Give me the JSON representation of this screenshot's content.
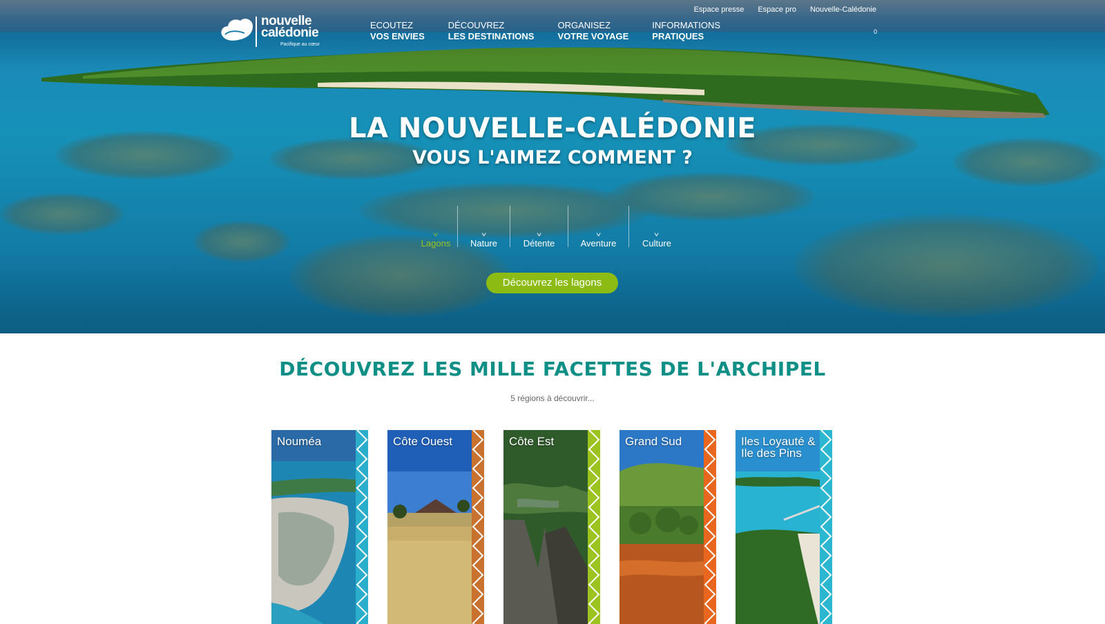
{
  "header": {
    "logo_line1": "nouvelle",
    "logo_line2": "calédonie",
    "logo_tagline": "Pacifique au cœur",
    "nav": [
      {
        "line1": "Ecoutez",
        "line2": "vos envies"
      },
      {
        "line1": "Découvrez",
        "line2": "les destinations"
      },
      {
        "line1": "Organisez",
        "line2": "votre voyage"
      },
      {
        "line1": "Informations",
        "line2": "pratiques"
      }
    ],
    "util_links": [
      "Espace presse",
      "Espace pro",
      "Nouvelle-Calédonie"
    ],
    "cart_count": "0"
  },
  "hero": {
    "title_line1": "La Nouvelle-Calédonie",
    "title_line2": "vous l'aimez comment ?",
    "tabs": [
      {
        "label": "Lagons",
        "active": true
      },
      {
        "label": "Nature",
        "active": false
      },
      {
        "label": "Détente",
        "active": false
      },
      {
        "label": "Aventure",
        "active": false
      },
      {
        "label": "Culture",
        "active": false
      }
    ],
    "cta_label": "Découvrez les lagons"
  },
  "section": {
    "title": "Découvrez les mille facettes de l'archipel",
    "subtitle": "5 régions à découvrir..."
  },
  "regions": [
    {
      "name": "Nouméa",
      "stripe_color": "#2aaecb"
    },
    {
      "name": "Côte Ouest",
      "stripe_color": "#c9712f"
    },
    {
      "name": "Côte Est",
      "stripe_color": "#9cc31e"
    },
    {
      "name": "Grand Sud",
      "stripe_color": "#e8661e"
    },
    {
      "name": "Iles Loyauté & Ile des Pins",
      "stripe_color": "#2ab7cf"
    }
  ],
  "colors": {
    "accent_green": "#8cbc14",
    "active_tab": "#9cc31e",
    "section_title": "#0f8f86"
  }
}
